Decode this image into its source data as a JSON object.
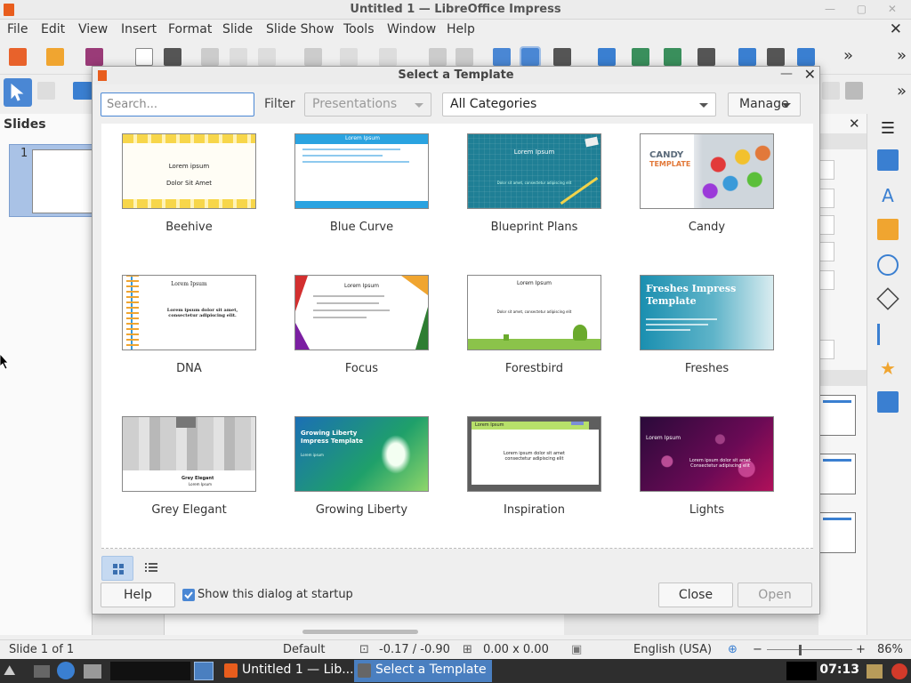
{
  "window": {
    "title": "Untitled 1 — LibreOffice Impress"
  },
  "menu": {
    "items": [
      "File",
      "Edit",
      "View",
      "Insert",
      "Format",
      "Slide",
      "Slide Show",
      "Tools",
      "Window",
      "Help"
    ]
  },
  "slides_pane": {
    "title": "Slides",
    "slide_number": "1"
  },
  "dialog": {
    "title": "Select a Template",
    "search_placeholder": "Search...",
    "filter_label": "Filter",
    "filter_value": "Presentations",
    "category_value": "All Categories",
    "manage_label": "Manage",
    "templates": [
      {
        "name": "Beehive"
      },
      {
        "name": "Blue Curve"
      },
      {
        "name": "Blueprint Plans"
      },
      {
        "name": "Candy"
      },
      {
        "name": "DNA"
      },
      {
        "name": "Focus"
      },
      {
        "name": "Forestbird"
      },
      {
        "name": "Freshes"
      },
      {
        "name": "Grey Elegant"
      },
      {
        "name": "Growing Liberty"
      },
      {
        "name": "Inspiration"
      },
      {
        "name": "Lights"
      }
    ],
    "previews": {
      "beehive": {
        "line1": "Lorem ipsum",
        "line2": "Dolor Sit Amet"
      },
      "blue_curve": {
        "title": "Lorem Ipsum"
      },
      "blueprint": {
        "title": "Lorem Ipsum",
        "sub": "Dolor sit amet, consectetur adipiscing elit"
      },
      "candy": {
        "line1": "CANDY",
        "line2": "TEMPLATE"
      },
      "dna": {
        "title": "Lorem Ipsum",
        "body": "Lorem ipsum dolor sit amet, consectetur adipiscing elit."
      },
      "focus": {
        "title": "Lorem Ipsum"
      },
      "forestbird": {
        "title": "Lorem Ipsum",
        "sub": "Dolor sit amet, consectetur adipiscing elit"
      },
      "freshes": {
        "title": "Freshes Impress Template"
      },
      "grey_elegant": {
        "title": "Grey Elegant",
        "sub": "Lorem Ipsum"
      },
      "growing_liberty": {
        "title": "Growing Liberty Impress Template",
        "sub": "Lorem ipsum"
      },
      "inspiration": {
        "title": "Lorem Ipsum",
        "body": "Lorem ipsum dolor sit amet consectetur adipiscing elit"
      },
      "lights": {
        "title": "Lorem Ipsum",
        "body": "Lorem ipsum dolor sit amet Consectetur adipiscing elit"
      }
    },
    "help_label": "Help",
    "startup_label": "Show this dialog at startup",
    "startup_checked": true,
    "close_label": "Close",
    "open_label": "Open"
  },
  "statusbar": {
    "slide_info": "Slide 1 of 1",
    "master": "Default",
    "position": "-0.17 / -0.90",
    "size": "0.00 x 0.00",
    "language": "English (USA)",
    "zoom": "86%"
  },
  "taskbar": {
    "tasks": [
      "Untitled 1 — Lib...",
      "Select a Template"
    ],
    "clock": "07:13"
  },
  "colors": {
    "accent": "#4a87d4",
    "app_orange": "#e85d1d",
    "taskbar_bg": "#2e2e2e"
  }
}
